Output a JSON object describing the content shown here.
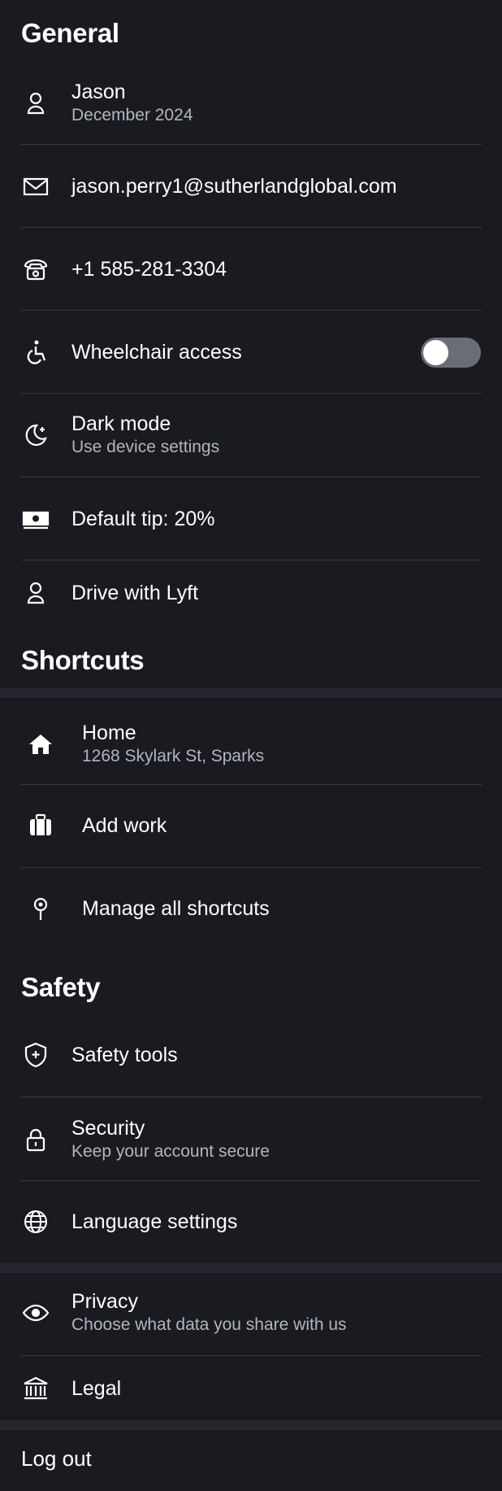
{
  "general": {
    "title": "General",
    "profile": {
      "name": "Jason",
      "member_since": "December 2024",
      "icon": "person-icon"
    },
    "email": {
      "value": "jason.perry1@sutherlandglobal.com",
      "icon": "envelope-icon"
    },
    "phone": {
      "value": "+1 585-281-3304",
      "icon": "phone-icon"
    },
    "wheelchair": {
      "label": "Wheelchair access",
      "enabled": false,
      "icon": "wheelchair-icon"
    },
    "dark_mode": {
      "label": "Dark mode",
      "value": "Use device settings",
      "icon": "moon-icon"
    },
    "default_tip": {
      "label": "Default tip: 20%",
      "icon": "cash-icon"
    },
    "drive": {
      "label": "Drive with Lyft",
      "icon": "person-icon"
    }
  },
  "shortcuts": {
    "title": "Shortcuts",
    "home": {
      "label": "Home",
      "address": "1268 Skylark St, Sparks",
      "icon": "house-icon"
    },
    "work": {
      "label": "Add work",
      "icon": "briefcase-icon"
    },
    "manage": {
      "label": "Manage all shortcuts",
      "icon": "pin-icon"
    }
  },
  "safety": {
    "title": "Safety",
    "tools": {
      "label": "Safety tools",
      "icon": "shield-icon"
    },
    "security": {
      "label": "Security",
      "sub": "Keep your account secure",
      "icon": "lock-icon"
    },
    "language": {
      "label": "Language settings",
      "icon": "globe-icon"
    }
  },
  "privacy": {
    "label": "Privacy",
    "sub": "Choose what data you share with us",
    "icon": "eye-icon"
  },
  "legal": {
    "label": "Legal",
    "icon": "bank-icon"
  },
  "logout": {
    "label": "Log out"
  },
  "colors": {
    "background": "#1a1b21",
    "divider": "#3a3b42",
    "subtext": "#b3b5bd",
    "toggle_off": "#6b6d75"
  }
}
